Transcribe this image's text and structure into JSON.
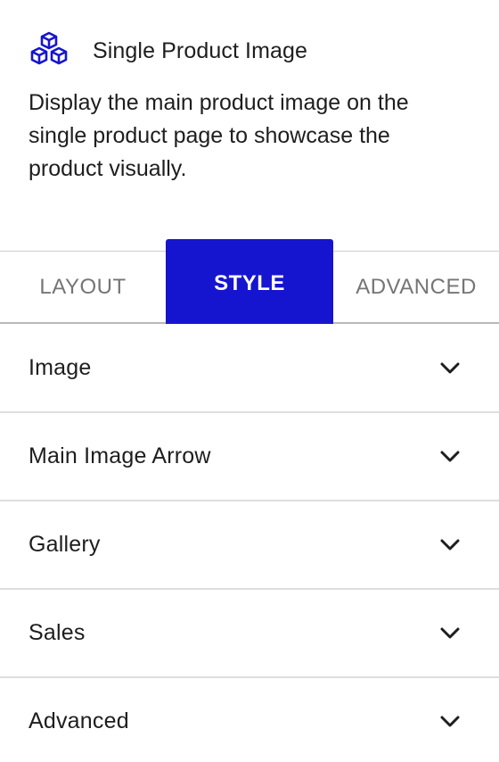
{
  "block": {
    "icon": "cubes-icon",
    "title": "Single Product Image",
    "description": "Display the main product image on the single product page to showcase the product visually."
  },
  "tabs": [
    {
      "label": "LAYOUT",
      "active": false
    },
    {
      "label": "STYLE",
      "active": true
    },
    {
      "label": "ADVANCED",
      "active": false
    }
  ],
  "sections": [
    {
      "label": "Image",
      "icon": "chevron-down-icon"
    },
    {
      "label": "Main Image Arrow",
      "icon": "chevron-down-icon"
    },
    {
      "label": "Gallery",
      "icon": "chevron-down-icon"
    },
    {
      "label": "Sales",
      "icon": "chevron-down-icon"
    },
    {
      "label": "Advanced",
      "icon": "chevron-down-icon"
    }
  ],
  "colors": {
    "accent": "#1515cf",
    "text": "#1e1e1e",
    "muted_tab": "#757575",
    "divider": "#dddddd"
  }
}
